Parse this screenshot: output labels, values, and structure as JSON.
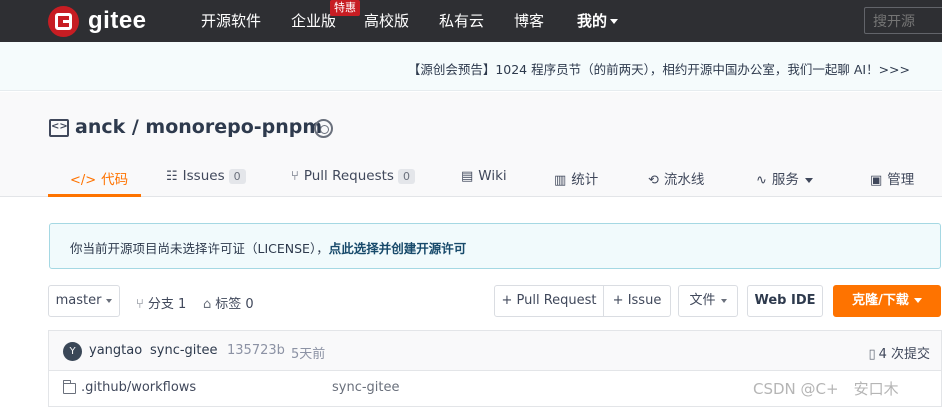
{
  "nav": {
    "logo_text": "gitee",
    "items": [
      "开源软件",
      "企业版",
      "高校版",
      "私有云",
      "博客",
      "我的"
    ],
    "enterprise_badge": "特惠",
    "search_placeholder": "搜开源"
  },
  "announcement": "【源创会预告】1024 程序员节（的前两天），相约开源中国办公室，我们一起聊 AI！>>>",
  "repo": {
    "title": "anck / monorepo-pnpm"
  },
  "tabs": {
    "code": "代码",
    "issues": "Issues",
    "issues_count": "0",
    "pulls": "Pull Requests",
    "pulls_count": "0",
    "wiki": "Wiki",
    "stats": "统计",
    "pipeline": "流水线",
    "services": "服务",
    "manage": "管理"
  },
  "license": {
    "text": "你当前开源项目尚未选择许可证（LICENSE），",
    "link": "点此选择并创建开源许可"
  },
  "toolbar": {
    "branch": "master",
    "branches": "分支 1",
    "tags": "标签 0",
    "pull_request": "+ Pull Request",
    "issue": "+ Issue",
    "files": "文件",
    "web_ide": "Web IDE",
    "clone": "克隆/下载"
  },
  "commit": {
    "avatar_letter": "Y",
    "author": "yangtao",
    "message": "sync-gitee",
    "hash": "135723b",
    "time": "5天前",
    "count": "4 次提交"
  },
  "files": [
    {
      "name": ".github/workflows",
      "commit": "sync-gitee"
    }
  ],
  "watermark": "CSDN @C+　安口木"
}
